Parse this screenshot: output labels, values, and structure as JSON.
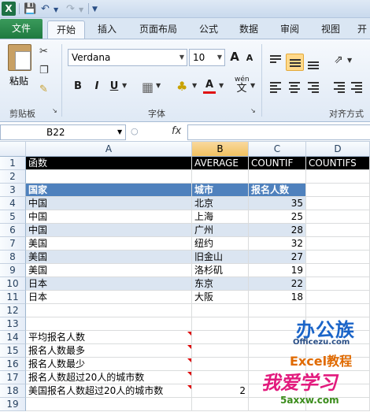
{
  "qat": {
    "undo_icon": "undo-icon",
    "redo_icon": "redo-icon",
    "save_icon": "save-icon"
  },
  "tabs": {
    "file": "文件",
    "items": [
      "开始",
      "插入",
      "页面布局",
      "公式",
      "数据",
      "审阅",
      "视图",
      "开"
    ]
  },
  "ribbon": {
    "paste_label": "粘贴",
    "clipboard_label": "剪贴板",
    "font_name": "Verdana",
    "font_size": "10",
    "font_group_label": "字体",
    "align_group_label": "对齐方式",
    "bold": "B",
    "italic": "I",
    "underline": "U",
    "grow_font": "A",
    "shrink_font": "A",
    "font_color": "A",
    "wen": "wén",
    "wen_char": "文"
  },
  "formula_bar": {
    "name_box": "B22",
    "fx": "fx",
    "value": ""
  },
  "columns": [
    "A",
    "B",
    "C",
    "D"
  ],
  "rows": [
    {
      "n": "1",
      "a": "函数",
      "b": "AVERAGE",
      "c": "COUNTIF",
      "d": "COUNTIFS"
    },
    {
      "n": "2",
      "a": "",
      "b": "",
      "c": "",
      "d": ""
    },
    {
      "n": "3",
      "a": "国家",
      "b": "城市",
      "c": "报名人数",
      "d": ""
    },
    {
      "n": "4",
      "a": "中国",
      "b": "北京",
      "c": "35",
      "d": ""
    },
    {
      "n": "5",
      "a": "中国",
      "b": "上海",
      "c": "25",
      "d": ""
    },
    {
      "n": "6",
      "a": "中国",
      "b": "广州",
      "c": "28",
      "d": ""
    },
    {
      "n": "7",
      "a": "美国",
      "b": "纽约",
      "c": "32",
      "d": ""
    },
    {
      "n": "8",
      "a": "美国",
      "b": "旧金山",
      "c": "27",
      "d": ""
    },
    {
      "n": "9",
      "a": "美国",
      "b": "洛杉矶",
      "c": "19",
      "d": ""
    },
    {
      "n": "10",
      "a": "日本",
      "b": "东京",
      "c": "22",
      "d": ""
    },
    {
      "n": "11",
      "a": "日本",
      "b": "大阪",
      "c": "18",
      "d": ""
    },
    {
      "n": "12",
      "a": "",
      "b": "",
      "c": "",
      "d": ""
    },
    {
      "n": "13",
      "a": "",
      "b": "",
      "c": "",
      "d": ""
    },
    {
      "n": "14",
      "a": "平均报名人数",
      "b": "",
      "c": "",
      "d": ""
    },
    {
      "n": "15",
      "a": "报名人数最多",
      "b": "",
      "c": "",
      "d": ""
    },
    {
      "n": "16",
      "a": "报名人数最少",
      "b": "",
      "c": "",
      "d": ""
    },
    {
      "n": "17",
      "a": "报名人数超过20人的城市数",
      "b": "",
      "c": "",
      "d": ""
    },
    {
      "n": "18",
      "a": "美国报名人数超过20人的城市数",
      "b": "2",
      "c": "",
      "d": ""
    },
    {
      "n": "19",
      "a": "",
      "b": "",
      "c": "",
      "d": ""
    }
  ],
  "watermark": {
    "line1": "办公族",
    "line2": "Officezu.com",
    "line3": "Excel教程",
    "line4": "我爱学习",
    "line5": "5axxw.com"
  }
}
